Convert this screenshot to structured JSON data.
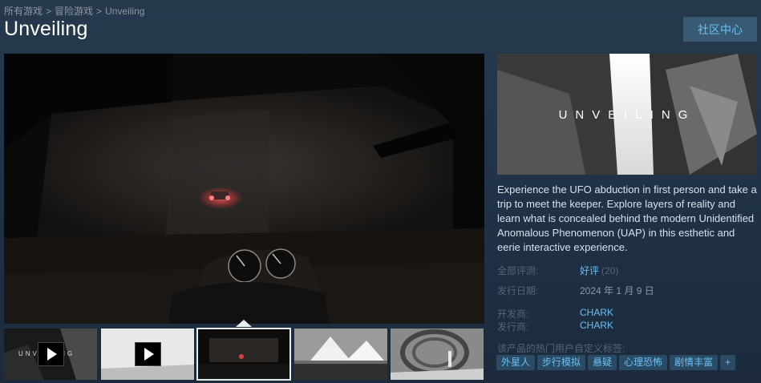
{
  "breadcrumb": {
    "item1": "所有游戏",
    "item2": "冒险游戏",
    "item3": "Unveiling",
    "separator": ">"
  },
  "title": "Unveiling",
  "community_button": "社区中心",
  "capsule": {
    "logo_text": "UNVEILING"
  },
  "thumbnails": [
    {
      "name": "trailer-1",
      "is_video": true,
      "logo_text": "UNVEILING"
    },
    {
      "name": "trailer-2",
      "is_video": true
    },
    {
      "name": "screenshot-car",
      "is_video": false,
      "selected": true
    },
    {
      "name": "screenshot-triangles",
      "is_video": false
    },
    {
      "name": "screenshot-tunnel",
      "is_video": false
    }
  ],
  "description": "Experience the UFO abduction in first person and take a trip to meet the keeper. Explore layers of reality and learn what is concealed behind the modern Unidentified Anomalous Phenomenon (UAP) in this esthetic and eerie interactive experience.",
  "reviews": {
    "label": "全部评测:",
    "summary": "好评",
    "count": "(20)"
  },
  "release": {
    "label": "发行日期:",
    "date": "2024 年 1 月 9 日"
  },
  "developer": {
    "label": "开发商:",
    "name": "CHARK"
  },
  "publisher": {
    "label": "发行商:",
    "name": "CHARK"
  },
  "tags_label": "该产品的热门用户自定义标签:",
  "tags": [
    "外星人",
    "步行模拟",
    "悬疑",
    "心理恐怖",
    "剧情丰富",
    "+"
  ],
  "colors": {
    "link": "#66c0f4",
    "tag_bg": "#2b4a63",
    "button_bg": "#3a5a73"
  }
}
